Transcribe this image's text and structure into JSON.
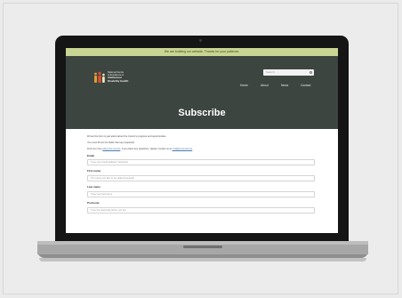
{
  "banner": {
    "text": "We are building our website. Thanks for your patience."
  },
  "logo": {
    "lines": [
      "National Centre",
      "of Excellence in"
    ],
    "bold_lines": [
      "Intellectual",
      "Disability Health"
    ],
    "colors": [
      "#e59b36",
      "#d9512b",
      "#f0e3bf"
    ]
  },
  "search": {
    "placeholder": "Search"
  },
  "nav": {
    "items": [
      "Home",
      "About",
      "News",
      "Contact"
    ]
  },
  "page": {
    "title": "Subscribe"
  },
  "intro": {
    "line1": "Fill out the form to get alerts about the Centre's progress and opportunities.",
    "line2": "You must fill out the fields that say (required).",
    "line3_prefix": "Find out more ",
    "line3_link": "about the Centre",
    "line3_middle": ". If you have any questions, please contact us at ",
    "line3_email": "ncid@unsw.edu.au"
  },
  "form": {
    "fields": [
      {
        "label": "Email",
        "placeholder": "Type your email address (required)"
      },
      {
        "label": "First name",
        "placeholder": "The name you like to be called (required)"
      },
      {
        "label": "Last name",
        "placeholder": "Type your last name"
      },
      {
        "label": "Postcode",
        "placeholder": "Type the postcode where you live"
      }
    ]
  },
  "colors": {
    "banner": "#c9d592",
    "header": "#3d4541",
    "laptop_bezel": "#151515",
    "laptop_base": "#a7a7a7"
  }
}
